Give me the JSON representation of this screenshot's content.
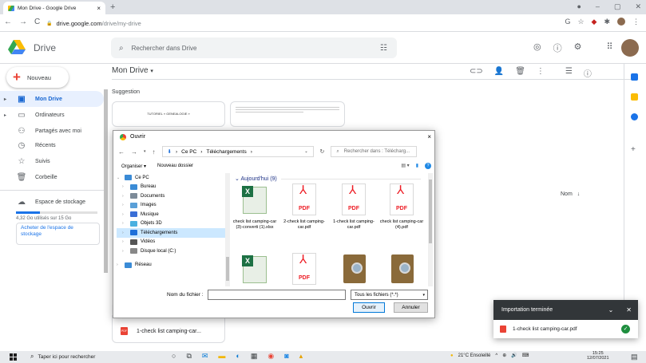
{
  "browser": {
    "tab_title": "Mon Drive - Google Drive",
    "tab_close": "×",
    "new_tab": "+",
    "url_host": "drive.google.com",
    "url_path": "/drive/my-drive"
  },
  "drive": {
    "app_name": "Drive",
    "search_placeholder": "Rechercher dans Drive",
    "new_button": "Nouveau",
    "page_title": "Mon Drive",
    "suggestion": "Suggestion",
    "name_header": "Nom",
    "suggested_files": [
      {
        "label": "1-check list camping-car..."
      }
    ],
    "card1_text": "TUTORIEL « GENEALOGIE »"
  },
  "sidebar": {
    "items": [
      {
        "label": "Mon Drive",
        "icon": "drive-icon"
      },
      {
        "label": "Ordinateurs",
        "icon": "computer-icon"
      },
      {
        "label": "Partagés avec moi",
        "icon": "people-icon"
      },
      {
        "label": "Récents",
        "icon": "clock-icon"
      },
      {
        "label": "Suivis",
        "icon": "star-icon"
      },
      {
        "label": "Corbeille",
        "icon": "trash-icon"
      },
      {
        "label": "Espace de stockage",
        "icon": "cloud-icon"
      }
    ],
    "quota_text": "4,32 Go utilisés sur 15 Go",
    "quota_fraction": 0.29,
    "buy_storage": "Acheter de l'espace de stockage"
  },
  "dialog": {
    "title": "Ouvrir",
    "close": "×",
    "breadcrumb": [
      "Ce PC",
      "Téléchargements"
    ],
    "search_placeholder": "Rechercher dans : Télécharg...",
    "organize": "Organiser ▾",
    "new_folder": "Nouveau dossier",
    "tree": [
      {
        "label": "Ce PC",
        "color": "#3a8bd6"
      },
      {
        "label": "Bureau",
        "color": "#3a8bd6"
      },
      {
        "label": "Documents",
        "color": "#7d8b99"
      },
      {
        "label": "Images",
        "color": "#5aa0d8"
      },
      {
        "label": "Musique",
        "color": "#3a6fd6"
      },
      {
        "label": "Objets 3D",
        "color": "#4ab0e0"
      },
      {
        "label": "Téléchargements",
        "color": "#1e6fd9"
      },
      {
        "label": "Vidéos",
        "color": "#555555"
      },
      {
        "label": "Disque local (C:)",
        "color": "#888888"
      },
      {
        "label": "Réseau",
        "color": "#3a8bd6"
      }
    ],
    "group_header": "Aujourd'hui (9)",
    "files": [
      {
        "name": "check list camping-car (3)-converti (1).xlsx",
        "kind": "xlsx"
      },
      {
        "name": "2-check list camping-car.pdf",
        "kind": "pdf"
      },
      {
        "name": "1-check list camping-car.pdf",
        "kind": "pdf"
      },
      {
        "name": "check list camping-car (4).pdf",
        "kind": "pdf"
      },
      {
        "name": "",
        "kind": "xlsx"
      },
      {
        "name": "",
        "kind": "pdf"
      },
      {
        "name": "",
        "kind": "book"
      },
      {
        "name": "",
        "kind": "book"
      }
    ],
    "filename_label": "Nom du fichier :",
    "filetype": "Tous les fichiers (*.*)",
    "open_button": "Ouvrir",
    "cancel_button": "Annuler"
  },
  "toast": {
    "title": "Importation terminée",
    "file": "1-check list camping-car.pdf"
  },
  "taskbar": {
    "search_placeholder": "Taper ici pour rechercher",
    "weather": "21°C Ensoleillé",
    "time": "15:25",
    "date": "12/07/2021"
  },
  "colors": {
    "accent": "#1a73e8",
    "active_bg": "#e8f0fe",
    "toast_bg": "#323639",
    "pdf_red": "#ea4335"
  }
}
